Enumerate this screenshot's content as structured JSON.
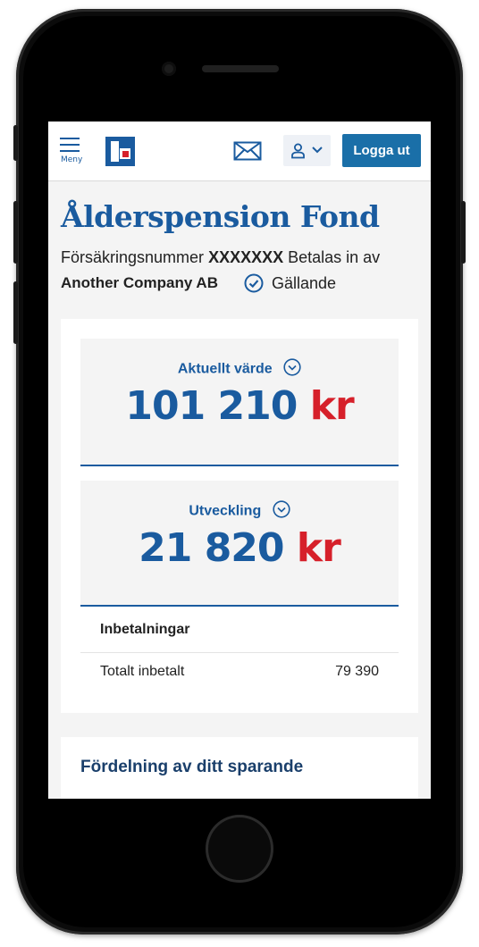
{
  "header": {
    "menu_label": "Meny",
    "logout_label": "Logga ut"
  },
  "page": {
    "title": "Ålderspension Fond",
    "insurance_number_label": "Försäkringsnummer",
    "insurance_number_value": "XXXXXXX",
    "paid_by_label": "Betalas in av",
    "company": "Another Company AB",
    "status": "Gällande"
  },
  "summary": {
    "current_value_label": "Aktuellt värde",
    "current_value_amount": "101 210",
    "current_value_unit": "kr",
    "development_label": "Utveckling",
    "development_amount": "21 820",
    "development_unit": "kr"
  },
  "payments": {
    "heading": "Inbetalningar",
    "total_label": "Totalt inbetalt",
    "total_value": "79 390"
  },
  "distribution": {
    "heading": "Fördelning av ditt sparande"
  },
  "colors": {
    "brand_blue": "#1a5b9f",
    "accent_red": "#d6202a",
    "button_blue": "#1a6fa8"
  },
  "icons": [
    "menu-icon",
    "logo-icon",
    "mail-icon",
    "user-icon",
    "chevron-down-icon",
    "check-circle-icon"
  ]
}
